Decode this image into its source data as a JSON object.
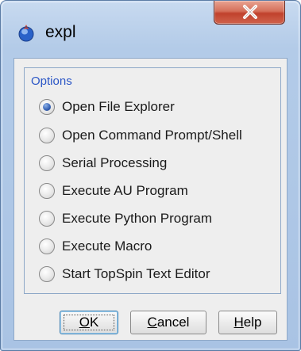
{
  "window": {
    "title": "expl",
    "app_icon": "topspin-logo-icon",
    "close_icon": "close-icon",
    "close_symbol": "X"
  },
  "options": {
    "group_title": "Options",
    "items": [
      {
        "label": "Open File Explorer",
        "checked": true
      },
      {
        "label": "Open Command Prompt/Shell",
        "checked": false
      },
      {
        "label": "Serial Processing",
        "checked": false
      },
      {
        "label": "Execute AU Program",
        "checked": false
      },
      {
        "label": "Execute Python Program",
        "checked": false
      },
      {
        "label": "Execute Macro",
        "checked": false
      },
      {
        "label": "Start TopSpin Text Editor",
        "checked": false
      }
    ]
  },
  "buttons": {
    "ok": {
      "accel": "O",
      "rest": "K"
    },
    "cancel": {
      "accel": "C",
      "rest": "ancel"
    },
    "help": {
      "accel": "H",
      "rest": "elp"
    }
  },
  "colors": {
    "group_title": "#2b56c6",
    "close_button": "#c0412c",
    "radio_selected": "#3a66b8"
  }
}
